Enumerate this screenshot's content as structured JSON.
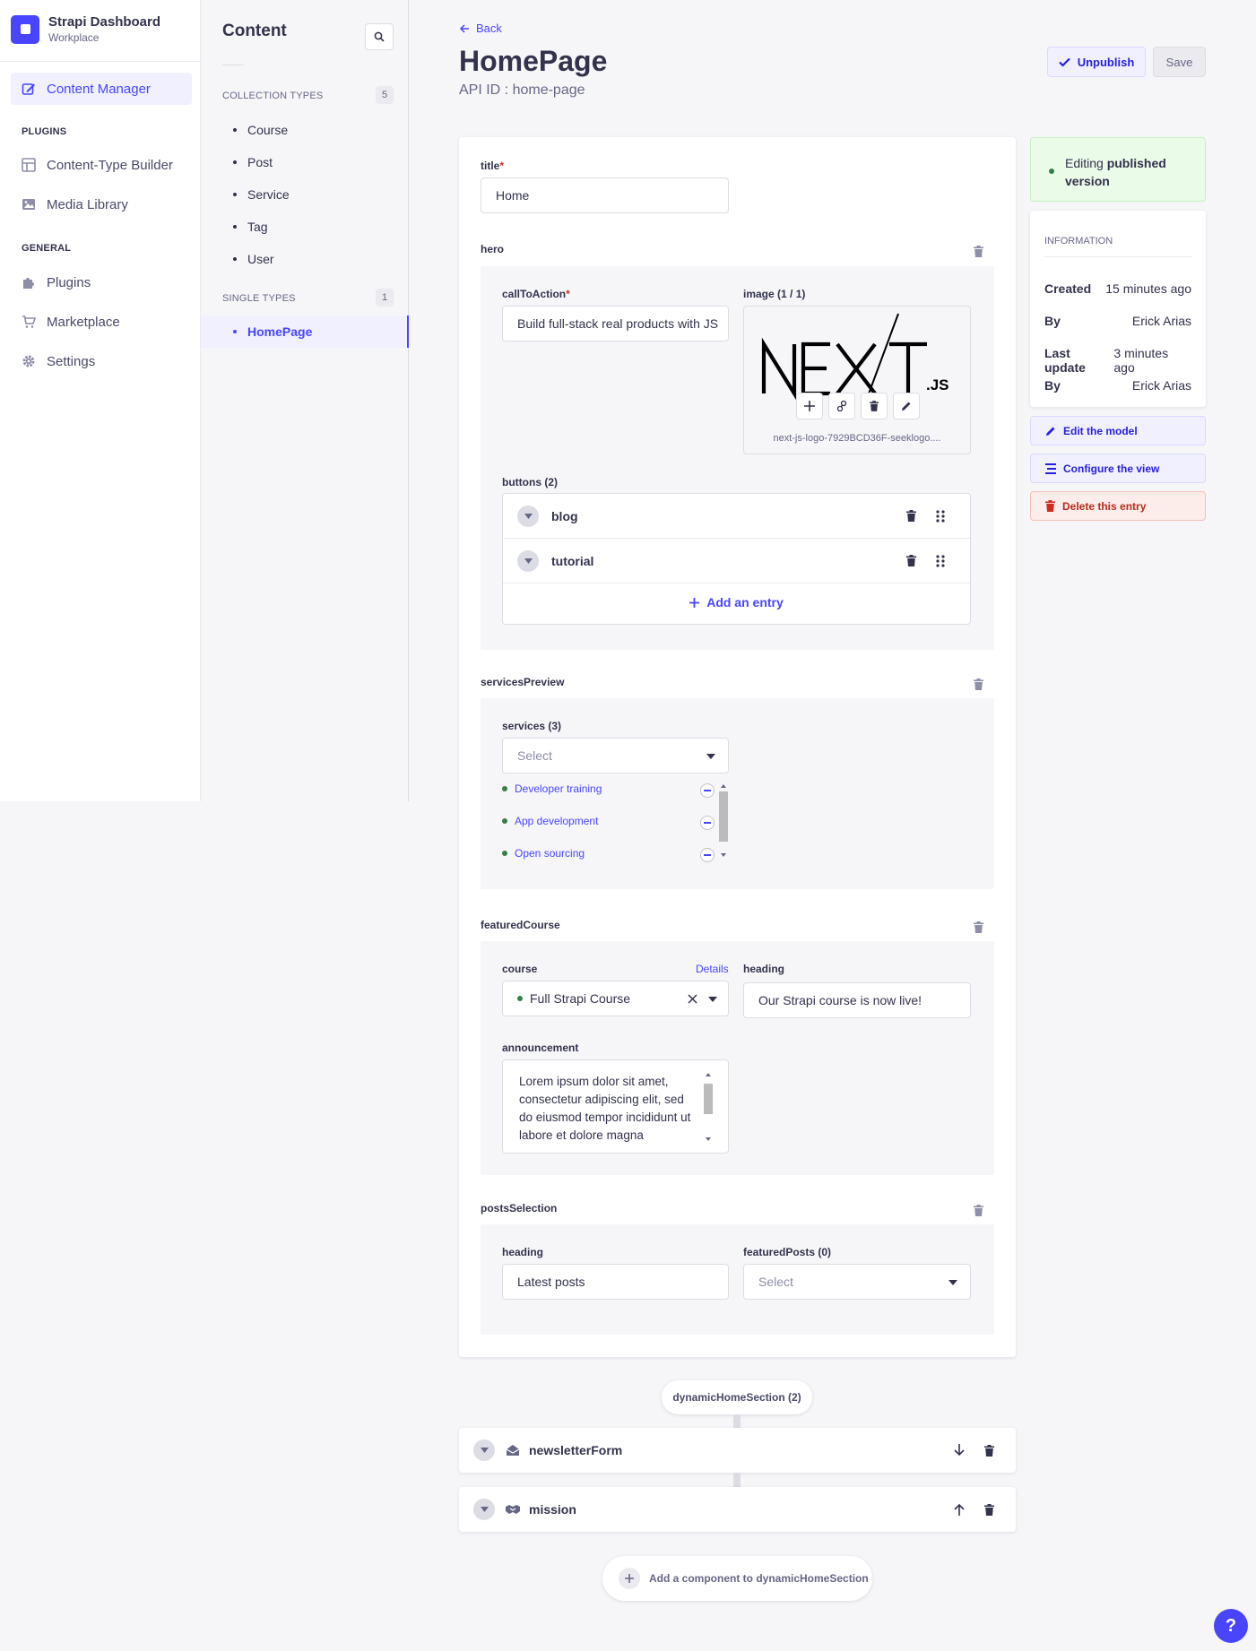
{
  "brand": {
    "title": "Strapi Dashboard",
    "subtitle": "Workplace"
  },
  "sidebar": {
    "content_manager": "Content Manager",
    "plugins_heading": "PLUGINS",
    "content_type_builder": "Content-Type Builder",
    "media_library": "Media Library",
    "general_heading": "GENERAL",
    "plugins": "Plugins",
    "marketplace": "Marketplace",
    "settings": "Settings"
  },
  "content_panel": {
    "title": "Content",
    "collection_heading": "COLLECTION TYPES",
    "collection_count": "5",
    "collection_items": [
      "Course",
      "Post",
      "Service",
      "Tag",
      "User"
    ],
    "single_heading": "SINGLE TYPES",
    "single_count": "1",
    "single_items": [
      "HomePage"
    ]
  },
  "header": {
    "back": "Back",
    "title": "HomePage",
    "api_id": "API ID : home-page",
    "unpublish": "Unpublish",
    "save": "Save"
  },
  "form": {
    "title": {
      "label": "title",
      "value": "Home"
    },
    "hero": {
      "label": "hero",
      "call_to_action": {
        "label": "callToAction",
        "value": "Build full-stack real products with JS"
      },
      "image": {
        "label": "image (1 / 1)",
        "filename": "next-js-logo-7929BCD36F-seeklogo...."
      },
      "buttons": {
        "label": "buttons (2)",
        "items": [
          "blog",
          "tutorial"
        ],
        "add": "Add an entry"
      }
    },
    "services_preview": {
      "label": "servicesPreview",
      "services": {
        "label": "services (3)",
        "placeholder": "Select",
        "items": [
          "Developer training",
          "App development",
          "Open sourcing"
        ]
      }
    },
    "featured_course": {
      "label": "featuredCourse",
      "course": {
        "label": "course",
        "details": "Details",
        "value": "Full Strapi Course"
      },
      "heading": {
        "label": "heading",
        "value": "Our Strapi course is now live!"
      },
      "announcement": {
        "label": "announcement",
        "value": "Lorem ipsum dolor sit amet, consectetur adipiscing elit, sed do eiusmod tempor incididunt ut labore et dolore magna"
      }
    },
    "posts_selection": {
      "label": "postsSelection",
      "heading": {
        "label": "heading",
        "value": "Latest posts"
      },
      "featured_posts": {
        "label": "featuredPosts (0)",
        "placeholder": "Select"
      }
    }
  },
  "right_panel": {
    "status_prefix": "Editing ",
    "status_strong": "published version",
    "info_heading": "INFORMATION",
    "info": [
      {
        "key": "Created",
        "value": "15 minutes ago"
      },
      {
        "key": "By",
        "value": "Erick Arias"
      },
      {
        "key": "Last update",
        "value": "3 minutes ago"
      },
      {
        "key": "By",
        "value": "Erick Arias"
      }
    ],
    "edit_model": "Edit the model",
    "configure_view": "Configure the view",
    "delete_entry": "Delete this entry"
  },
  "dynamic_zone": {
    "label": "dynamicHomeSection (2)",
    "items": [
      "newsletterForm",
      "mission"
    ],
    "add": "Add a component to dynamicHomeSection"
  },
  "help": "?"
}
